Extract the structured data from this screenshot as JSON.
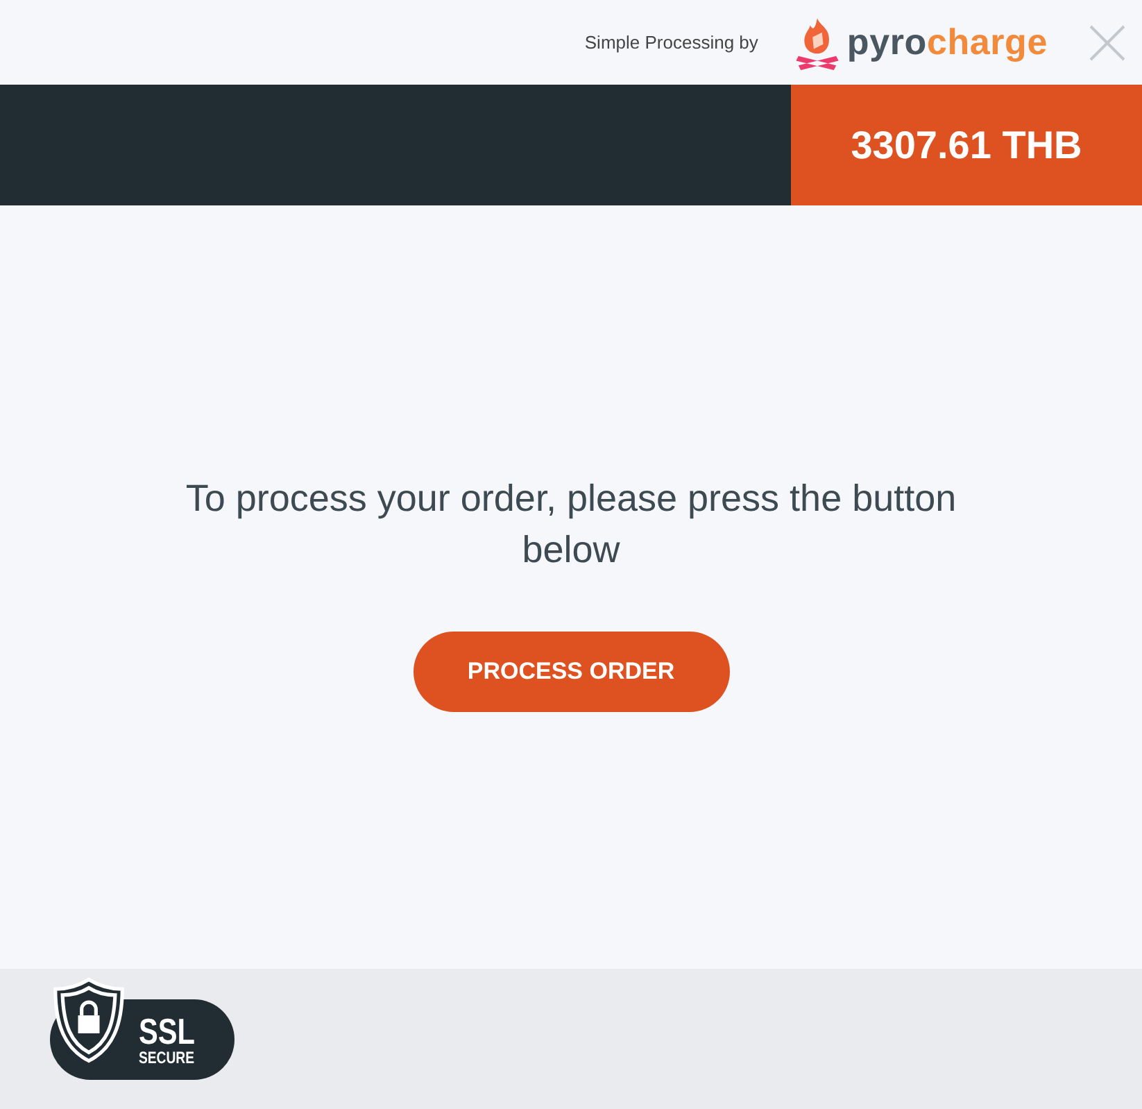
{
  "header": {
    "caption": "Simple Processing by",
    "logo": {
      "part_1": "pyro",
      "part_2": "charge"
    }
  },
  "amount": "3307.61 THB",
  "message": "To process your order, please press the button below",
  "button": "PROCESS ORDER",
  "badge": {
    "title": "SSL",
    "subtitle": "SECURE"
  }
}
